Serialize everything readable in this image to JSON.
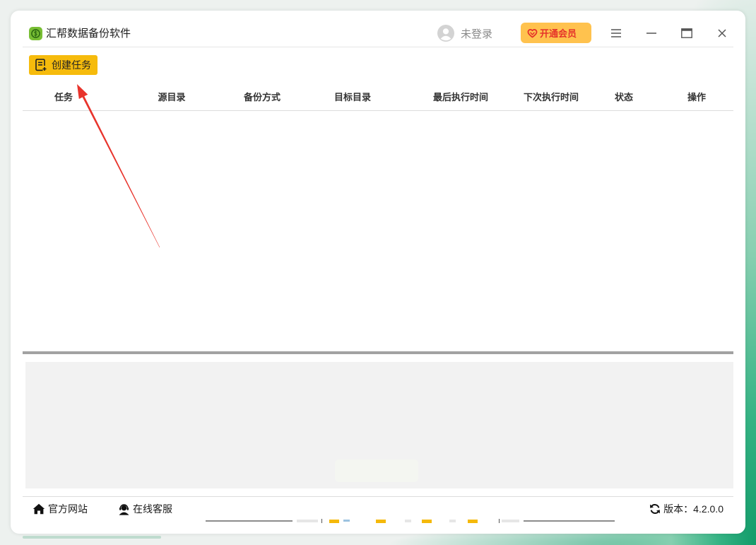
{
  "window": {
    "title": "汇帮数据备份软件",
    "login_status": "未登录",
    "vip_label": "开通会员"
  },
  "toolbar": {
    "create_task_label": "创建任务"
  },
  "table": {
    "columns": [
      "任务",
      "源目录",
      "备份方式",
      "目标目录",
      "最后执行时间",
      "下次执行时间",
      "状态",
      "操作"
    ],
    "rows": []
  },
  "footer": {
    "website_label": "官方网站",
    "support_label": "在线客服",
    "version_label": "版本：",
    "version_value": "4.2.0.0"
  },
  "icons": {
    "app_logo": "app-logo-icon",
    "avatar": "user-avatar-icon",
    "vip": "vip-heart-icon",
    "menu": "menu-icon",
    "minimize": "minimize-icon",
    "maximize": "maximize-icon",
    "close": "close-icon",
    "create_task": "create-task-icon",
    "website": "home-icon",
    "support": "customer-service-icon",
    "version": "refresh-icon"
  },
  "colors": {
    "accent": "#F6BB0C",
    "vip_background": "#FFC24E",
    "vip_text": "#E5332A",
    "logo_green": "#78BE34",
    "annotation_arrow": "#E8342C",
    "splitter": "#A2A2A2",
    "log_panel": "#F2F2F2"
  }
}
